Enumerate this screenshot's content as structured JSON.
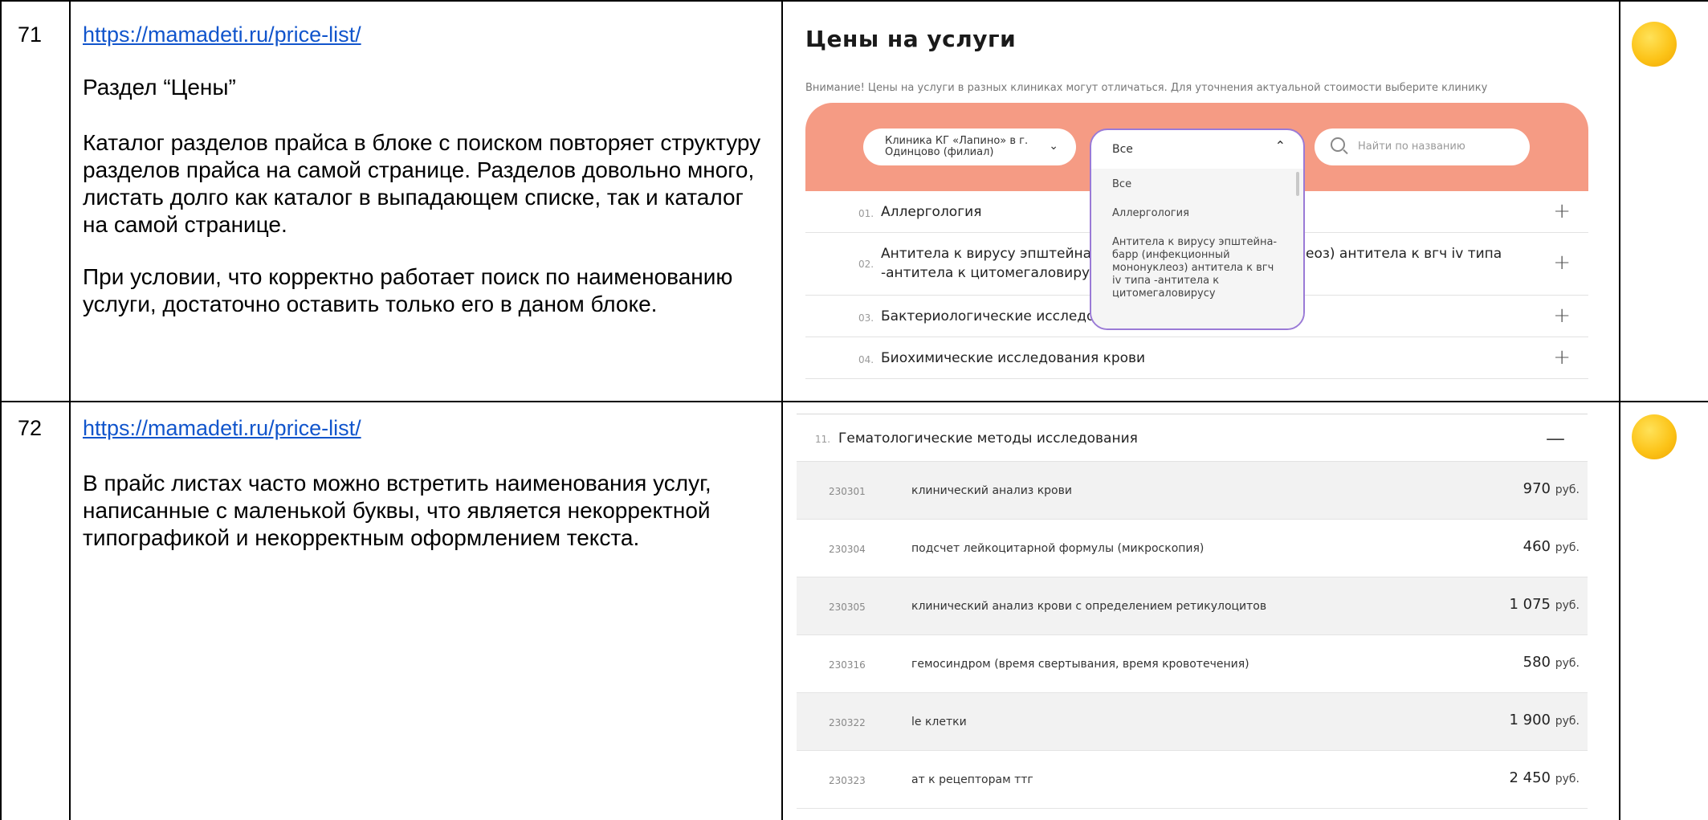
{
  "rows": [
    {
      "number": "71",
      "url": "https://mamadeti.ru/price-list/",
      "paragraphs": [
        "Раздел “Цены”",
        "Каталог разделов прайса в блоке с поиском повторяет структуру разделов прайса на самой странице. Разделов довольно много, листать долго как каталог в выпадающем списке, так и каталог на самой странице.",
        "При условии, что корректно работает поиск по наименованию услуги, достаточно оставить только его в даном блоке."
      ],
      "status_icon": "yellow-circle-icon",
      "status_color": "#fcc419"
    },
    {
      "number": "72",
      "url": "https://mamadeti.ru/price-list/",
      "paragraphs": [
        "В прайс листах часто можно встретить наименования услуг, написанные с маленькой буквы, что является некорректной типографикой и некорректным оформлением текста."
      ],
      "status_icon": "yellow-circle-icon",
      "status_color": "#fcc419"
    }
  ],
  "shot1": {
    "title": "Цены на услуги",
    "note": "Внимание! Цены на услуги в разных клиниках могут отличаться. Для уточнения актуальной стоимости выберите клинику",
    "clinic_select": "Клиника КГ «Лапино» в г. Одинцово (филиал)",
    "category_select": "Все",
    "search_placeholder": "Найти по названию",
    "dropdown_options": [
      "Все",
      "Аллергология",
      "Антитела к вирусу эпштейна-барр (инфекционный мононуклеоз) антитела к вгч iv типа -антитела к цитомегаловирусу"
    ],
    "sections": [
      {
        "num": "01.",
        "label": "Аллергология"
      },
      {
        "num": "02.",
        "label_line1": "Антитела к вирусу эпштейна-б",
        "label_line1_tail": "еоз) антитела к вгч iv типа",
        "label_line2": "-антитела к цитомегаловирусу"
      },
      {
        "num": "03.",
        "label": "Бактериологические исследов"
      },
      {
        "num": "04.",
        "label": "Биохимические исследования крови"
      }
    ],
    "brand_color": "#f59b84",
    "focus_color": "#9a7ad6"
  },
  "shot2": {
    "section_num": "11.",
    "section_label": "Гематологические методы исследования",
    "services": [
      {
        "code": "230301",
        "name": "клинический анализ крови",
        "price": "970",
        "currency": "руб."
      },
      {
        "code": "230304",
        "name": "подсчет лейкоцитарной формулы (микроскопия)",
        "price": "460",
        "currency": "руб."
      },
      {
        "code": "230305",
        "name": "клинический анализ крови с определением ретикулоцитов",
        "price": "1 075",
        "currency": "руб."
      },
      {
        "code": "230316",
        "name": "гемосиндром (время свертывания, время кровотечения)",
        "price": "580",
        "currency": "руб."
      },
      {
        "code": "230322",
        "name": "le клетки",
        "price": "1 900",
        "currency": "руб."
      },
      {
        "code": "230323",
        "name": "ат к рецепторам ттг",
        "price": "2 450",
        "currency": "руб."
      }
    ]
  }
}
